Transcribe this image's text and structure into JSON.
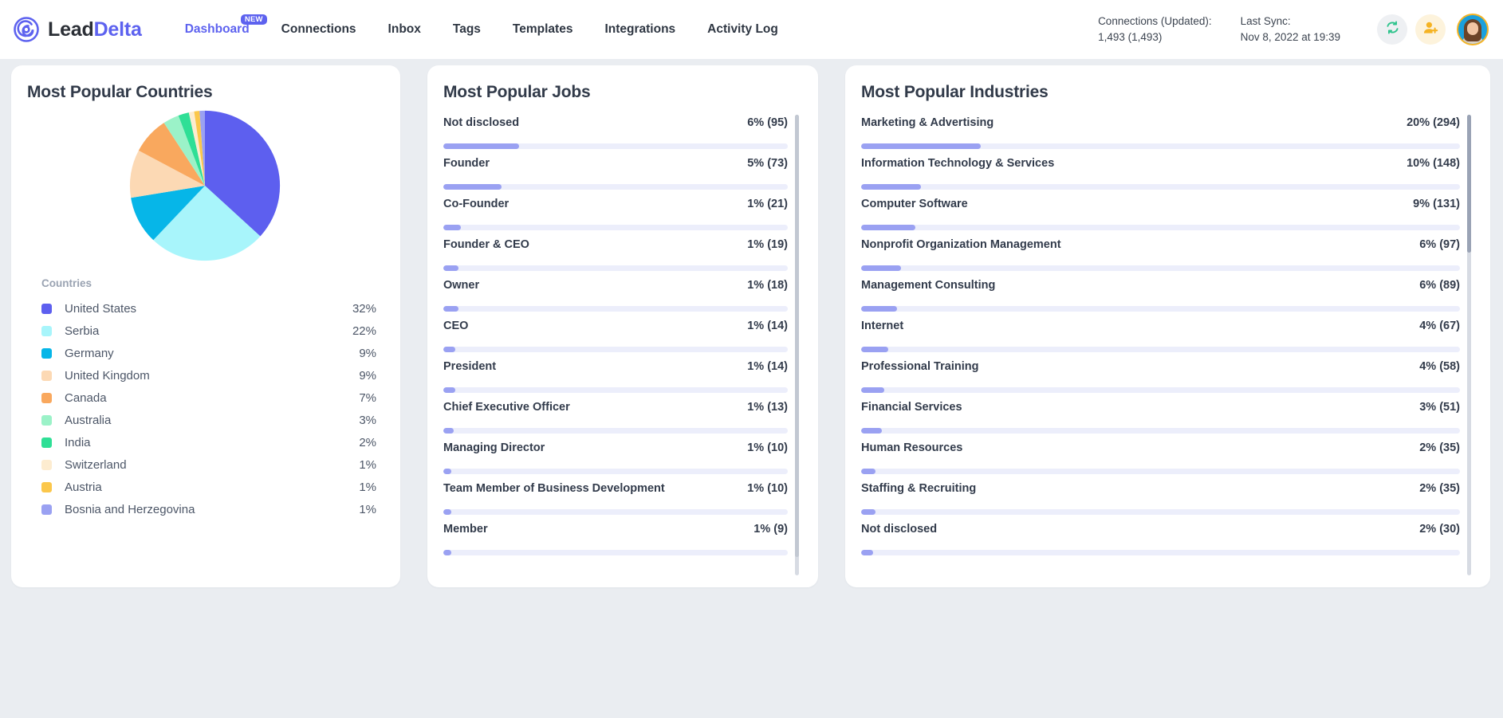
{
  "brand": {
    "lead": "Lead",
    "delta": "Delta",
    "logo_icon": "leaddelta-spiral-logo"
  },
  "nav": [
    {
      "label": "Dashboard",
      "active": true,
      "badge": "NEW"
    },
    {
      "label": "Connections",
      "active": false,
      "badge": ""
    },
    {
      "label": "Inbox",
      "active": false,
      "badge": ""
    },
    {
      "label": "Tags",
      "active": false,
      "badge": ""
    },
    {
      "label": "Templates",
      "active": false,
      "badge": ""
    },
    {
      "label": "Integrations",
      "active": false,
      "badge": ""
    },
    {
      "label": "Activity Log",
      "active": false,
      "badge": ""
    }
  ],
  "header_stats": {
    "connections_label": "Connections (Updated):",
    "connections_value": "1,493 (1,493)",
    "sync_label": "Last Sync:",
    "sync_value": "Nov 8, 2022 at 19:39"
  },
  "header_actions": {
    "sync_icon": "refresh-sync-icon",
    "invite_icon": "add-user-icon",
    "avatar_icon": "user-avatar"
  },
  "colors": {
    "accent": "#5d62ef",
    "bar_fill": "#9aa1f2",
    "bar_track": "#eceefb",
    "page_bg": "#eaedf1",
    "sync_green": "#2fc48d",
    "invite_yellow": "#f5b323"
  },
  "countries_card": {
    "title": "Most Popular Countries",
    "legend_header": "Countries"
  },
  "jobs_card": {
    "title": "Most Popular Jobs"
  },
  "industries_card": {
    "title": "Most Popular Industries"
  },
  "chart_data": [
    {
      "type": "pie",
      "title": "Most Popular Countries",
      "legend_position": "bottom",
      "labels": [
        "United States",
        "Serbia",
        "Germany",
        "United Kingdom",
        "Canada",
        "Australia",
        "India",
        "Switzerland",
        "Austria",
        "Bosnia and Herzegovina"
      ],
      "values": [
        32,
        22,
        9,
        9,
        7,
        3,
        2,
        1,
        1,
        1
      ],
      "display_values": [
        "32%",
        "22%",
        "9%",
        "9%",
        "7%",
        "3%",
        "2%",
        "1%",
        "1%",
        "1%"
      ],
      "colors": [
        "#5d5fef",
        "#a8f5fb",
        "#06b6e8",
        "#fcd9b4",
        "#f9a85e",
        "#9bf2c8",
        "#2fdf96",
        "#fdecd0",
        "#fbc council",
        "#9aa1f2"
      ]
    },
    {
      "type": "bar",
      "title": "Most Popular Jobs",
      "orientation": "horizontal",
      "categories": [
        "Not disclosed",
        "Founder",
        "Co-Founder",
        "Founder & CEO",
        "Owner",
        "CEO",
        "President",
        "Chief Executive Officer",
        "Managing Director",
        "Team Member of Business Development",
        "Member"
      ],
      "values": [
        6,
        5,
        1,
        1,
        1,
        1,
        1,
        1,
        1,
        1,
        1
      ],
      "counts": [
        95,
        73,
        21,
        19,
        18,
        14,
        14,
        13,
        10,
        10,
        9
      ],
      "display_values": [
        "6% (95)",
        "5% (73)",
        "1% (21)",
        "1% (19)",
        "1% (18)",
        "1% (14)",
        "1% (14)",
        "1% (13)",
        "1% (10)",
        "1% (10)",
        "1% (9)"
      ],
      "bar_pct": [
        22,
        17,
        5,
        4.5,
        4.3,
        3.4,
        3.4,
        3.1,
        2.4,
        2.4,
        2.2
      ],
      "ylabel": "",
      "xlabel": ""
    },
    {
      "type": "bar",
      "title": "Most Popular Industries",
      "orientation": "horizontal",
      "categories": [
        "Marketing & Advertising",
        "Information Technology & Services",
        "Computer Software",
        "Nonprofit Organization Management",
        "Management Consulting",
        "Internet",
        "Professional Training",
        "Financial Services",
        "Human Resources",
        "Staffing & Recruiting",
        "Not disclosed"
      ],
      "values": [
        20,
        10,
        9,
        6,
        6,
        4,
        4,
        3,
        2,
        2,
        2
      ],
      "counts": [
        294,
        148,
        131,
        97,
        89,
        67,
        58,
        51,
        35,
        35,
        30
      ],
      "display_values": [
        "20% (294)",
        "10% (148)",
        "9% (131)",
        "6% (97)",
        "6% (89)",
        "4% (67)",
        "4% (58)",
        "3% (51)",
        "2% (35)",
        "2% (35)",
        "2% (30)"
      ],
      "bar_pct": [
        20,
        10,
        9,
        6.6,
        6,
        4.5,
        3.9,
        3.4,
        2.4,
        2.4,
        2.0
      ],
      "ylabel": "",
      "xlabel": ""
    }
  ],
  "scrollbars": {
    "jobs": {
      "thumb_top_pct": 0,
      "thumb_height_pct": 96
    },
    "industries": {
      "thumb_top_pct": 0,
      "thumb_height_pct": 30
    }
  }
}
